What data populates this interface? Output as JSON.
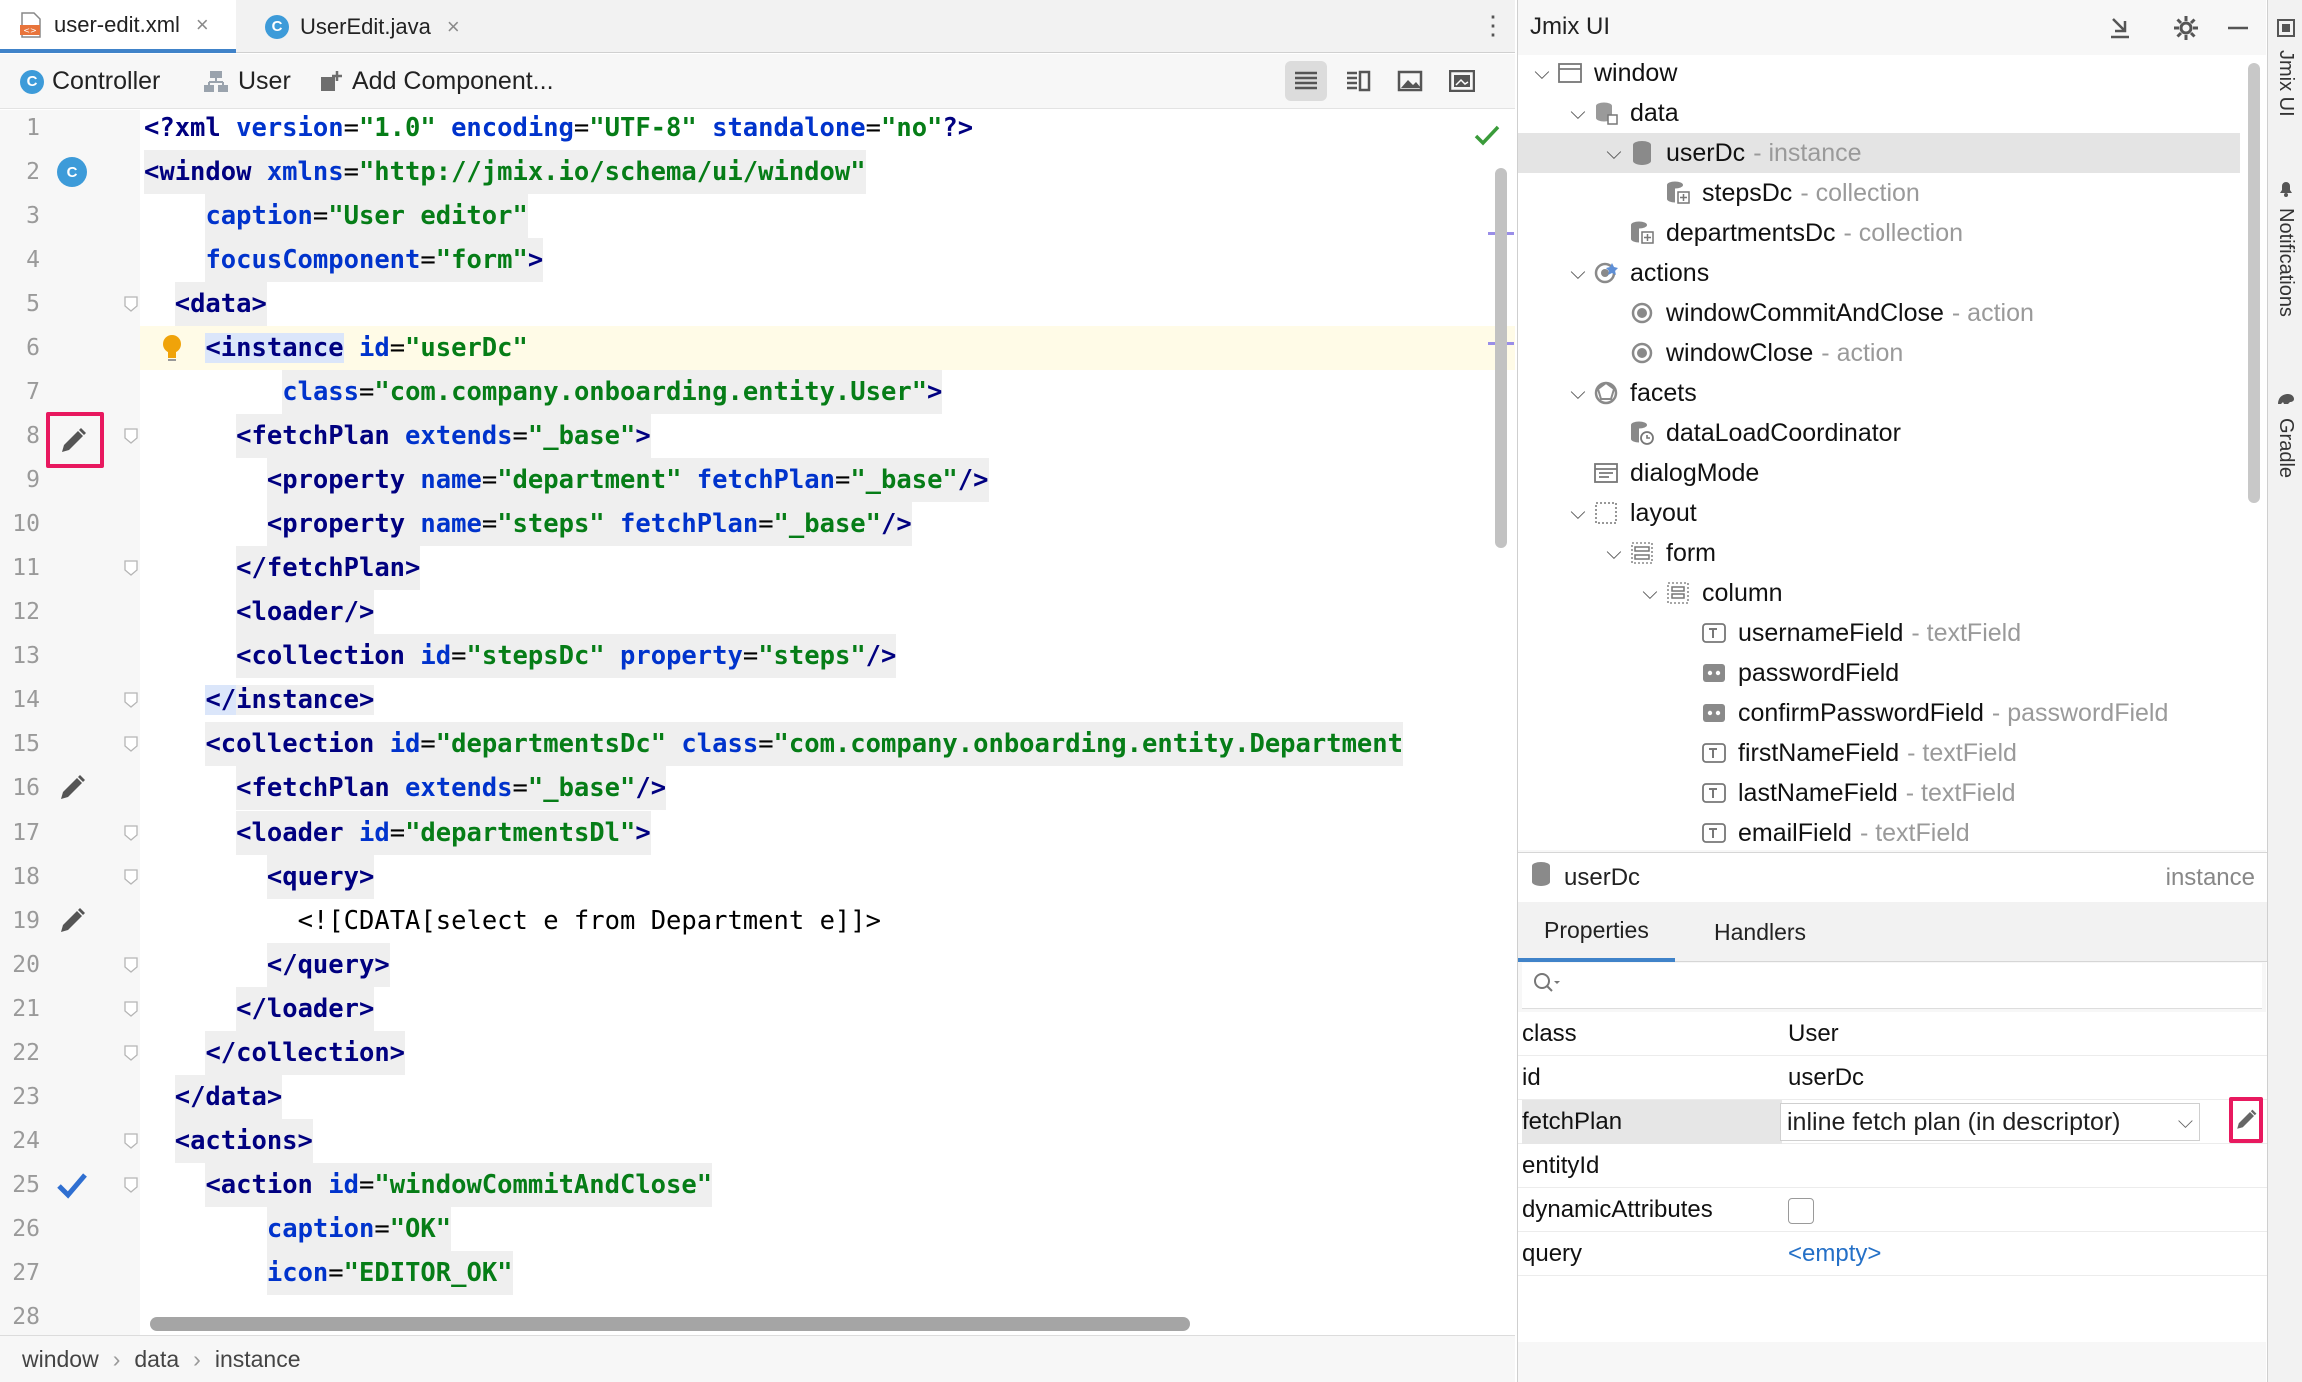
{
  "tabs": [
    {
      "label": "user-edit.xml",
      "close": "×"
    },
    {
      "label": "UserEdit.java",
      "close": "×"
    }
  ],
  "toolbar": {
    "controller": "Controller",
    "user": "User",
    "add_component": "Add Component..."
  },
  "code_lines": [
    "<?xml version=\"1.0\" encoding=\"UTF-8\" standalone=\"no\"?>",
    "<window xmlns=\"http://jmix.io/schema/ui/window\"",
    "caption=\"User editor\"",
    "focusComponent=\"form\">",
    "<data>",
    "<instance id=\"userDc\"",
    "class=\"com.company.onboarding.entity.User\">",
    "<fetchPlan extends=\"_base\">",
    "<property name=\"department\" fetchPlan=\"_base\"/>",
    "<property name=\"steps\" fetchPlan=\"_base\"/>",
    "</fetchPlan>",
    "<loader/>",
    "<collection id=\"stepsDc\" property=\"steps\"/>",
    "</instance>",
    "<collection id=\"departmentsDc\" class=\"com.company.onboarding.entity.Department",
    "<fetchPlan extends=\"_base\"/>",
    "<loader id=\"departmentsDl\">",
    "<query>",
    "<![CDATA[select e from Department e]]>",
    "</query>",
    "</loader>",
    "</collection>",
    "</data>",
    "<actions>",
    "<action id=\"windowCommitAndClose\"",
    "caption=\"OK\"",
    "icon=\"EDITOR_OK\"",
    ""
  ],
  "line_numbers": [
    "1",
    "2",
    "3",
    "4",
    "5",
    "6",
    "7",
    "8",
    "9",
    "10",
    "11",
    "12",
    "13",
    "14",
    "15",
    "16",
    "17",
    "18",
    "19",
    "20",
    "21",
    "22",
    "23",
    "24",
    "25",
    "26",
    "27",
    "28"
  ],
  "breadcrumb": [
    "window",
    "data",
    "instance"
  ],
  "panel": {
    "title": "Jmix UI"
  },
  "tree": [
    {
      "label": "window",
      "hint": "",
      "chev": "⌵"
    },
    {
      "label": "data",
      "hint": "",
      "chev": "⌵"
    },
    {
      "label": "userDc",
      "hint": "- instance",
      "chev": "⌵"
    },
    {
      "label": "stepsDc",
      "hint": "- collection",
      "chev": ""
    },
    {
      "label": "departmentsDc",
      "hint": "- collection",
      "chev": ""
    },
    {
      "label": "actions",
      "hint": "",
      "chev": "⌵"
    },
    {
      "label": "windowCommitAndClose",
      "hint": "- action",
      "chev": ""
    },
    {
      "label": "windowClose",
      "hint": "- action",
      "chev": ""
    },
    {
      "label": "facets",
      "hint": "",
      "chev": "⌵"
    },
    {
      "label": "dataLoadCoordinator",
      "hint": "",
      "chev": ""
    },
    {
      "label": "dialogMode",
      "hint": "",
      "chev": ""
    },
    {
      "label": "layout",
      "hint": "",
      "chev": "⌵"
    },
    {
      "label": "form",
      "hint": "",
      "chev": "⌵"
    },
    {
      "label": "column",
      "hint": "",
      "chev": "⌵"
    },
    {
      "label": "usernameField",
      "hint": "- textField",
      "chev": ""
    },
    {
      "label": "passwordField",
      "hint": "",
      "chev": ""
    },
    {
      "label": "confirmPasswordField",
      "hint": "- passwordField",
      "chev": ""
    },
    {
      "label": "firstNameField",
      "hint": "- textField",
      "chev": ""
    },
    {
      "label": "lastNameField",
      "hint": "- textField",
      "chev": ""
    },
    {
      "label": "emailField",
      "hint": "- textField",
      "chev": ""
    }
  ],
  "inspector": {
    "name": "userDc",
    "type": "instance",
    "tabs": [
      "Properties",
      "Handlers"
    ]
  },
  "properties": [
    {
      "name": "class",
      "value": "User"
    },
    {
      "name": "id",
      "value": "userDc"
    },
    {
      "name": "fetchPlan",
      "value": "inline fetch plan (in descriptor)"
    },
    {
      "name": "entityId",
      "value": ""
    },
    {
      "name": "dynamicAttributes",
      "value": ""
    },
    {
      "name": "query",
      "value": "<empty>"
    }
  ],
  "side_strip": [
    "Jmix UI",
    "Notifications",
    "Gradle"
  ]
}
